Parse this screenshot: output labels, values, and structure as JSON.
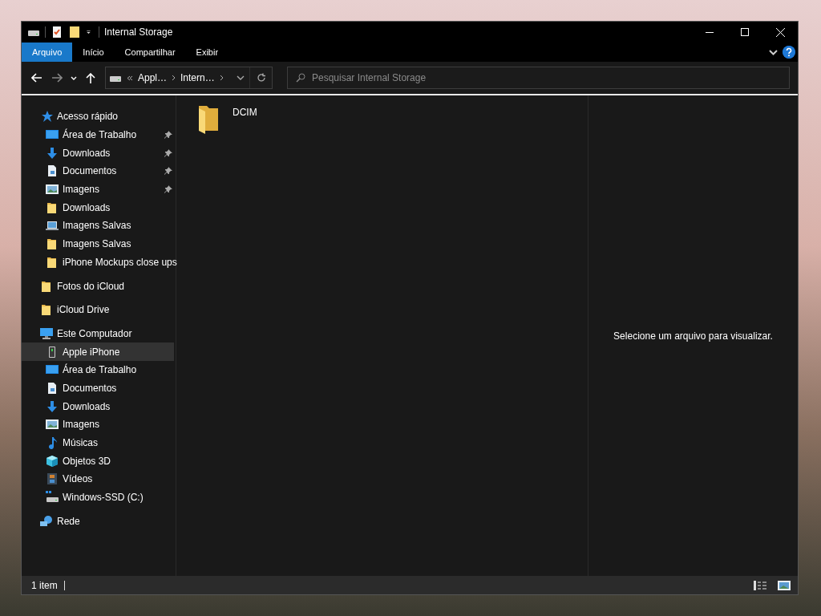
{
  "window": {
    "title": "Internal Storage"
  },
  "ribbon_tabs": [
    {
      "label": "Arquivo",
      "selected": true
    },
    {
      "label": "Início",
      "selected": false
    },
    {
      "label": "Compartilhar",
      "selected": false
    },
    {
      "label": "Exibir",
      "selected": false
    }
  ],
  "address": {
    "crumbs": [
      "Appl…",
      "Intern…"
    ]
  },
  "search": {
    "placeholder": "Pesquisar Internal Storage"
  },
  "nav": [
    {
      "label": "Acesso rápido",
      "kind": "star",
      "selected": false,
      "children": [
        {
          "label": "Área de Trabalho",
          "kind": "desktop",
          "pinned": true,
          "selected": false
        },
        {
          "label": "Downloads",
          "kind": "download",
          "pinned": true,
          "selected": false
        },
        {
          "label": "Documentos",
          "kind": "document",
          "pinned": true,
          "selected": false
        },
        {
          "label": "Imagens",
          "kind": "pictures",
          "pinned": true,
          "selected": false
        },
        {
          "label": "Downloads",
          "kind": "folder",
          "pinned": false,
          "selected": false
        },
        {
          "label": "Imagens Salvas",
          "kind": "laptop",
          "pinned": false,
          "selected": false
        },
        {
          "label": "Imagens Salvas",
          "kind": "folder",
          "pinned": false,
          "selected": false
        },
        {
          "label": "iPhone Mockups close ups",
          "kind": "folder",
          "pinned": false,
          "selected": false
        }
      ]
    },
    {
      "label": "Fotos do iCloud",
      "kind": "folder",
      "selected": false
    },
    {
      "label": "iCloud Drive",
      "kind": "folder",
      "selected": false
    },
    {
      "label": "Este Computador",
      "kind": "computer",
      "selected": false,
      "children": [
        {
          "label": "Apple iPhone",
          "kind": "phone",
          "selected": true
        },
        {
          "label": "Área de Trabalho",
          "kind": "desktop",
          "selected": false
        },
        {
          "label": "Documentos",
          "kind": "document",
          "selected": false
        },
        {
          "label": "Downloads",
          "kind": "download",
          "selected": false
        },
        {
          "label": "Imagens",
          "kind": "pictures",
          "selected": false
        },
        {
          "label": "Músicas",
          "kind": "music",
          "selected": false
        },
        {
          "label": "Objetos 3D",
          "kind": "cube",
          "selected": false
        },
        {
          "label": "Vídeos",
          "kind": "video",
          "selected": false
        },
        {
          "label": "Windows-SSD (C:)",
          "kind": "drive",
          "selected": false
        }
      ]
    },
    {
      "label": "Rede",
      "kind": "network",
      "selected": false
    }
  ],
  "files": [
    {
      "name": "DCIM",
      "kind": "folder"
    }
  ],
  "preview": {
    "message": "Selecione um arquivo para visualizar."
  },
  "status_bar": {
    "count": "1 item"
  }
}
